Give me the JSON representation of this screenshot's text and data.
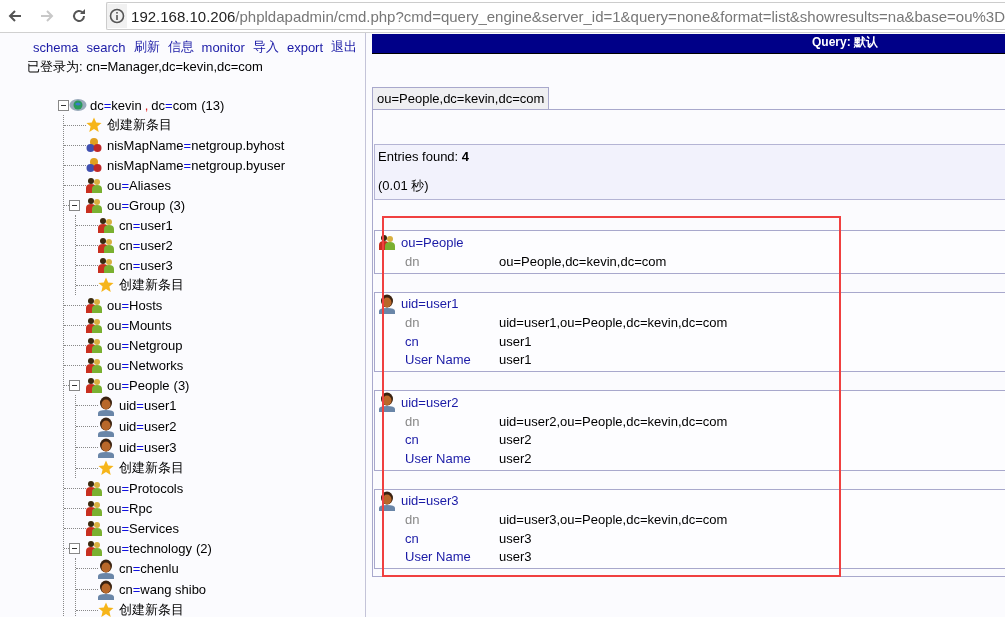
{
  "browser": {
    "nav": [
      {
        "kind": "back",
        "disabled": false
      },
      {
        "kind": "forward",
        "disabled": true
      },
      {
        "kind": "reload",
        "disabled": false
      }
    ],
    "address": {
      "host": "192.168.10.206",
      "path": "/phpldapadmin/cmd.php?cmd=query_engine&server_id=1&query=none&format=list&showresults=na&base=ou%3D"
    }
  },
  "menu": [
    "schema",
    "search",
    "刷新",
    "信息",
    "monitor",
    "导入",
    "export",
    "退出"
  ],
  "login": "已登录为: cn=Manager,dc=kevin,dc=com",
  "tree": {
    "kind": "server",
    "label": "dc=kevin,dc=com",
    "count": "(13)",
    "expanded": true,
    "children": [
      {
        "kind": "create",
        "label": "创建新条目"
      },
      {
        "kind": "nismap",
        "label": "nisMapName=netgroup.byhost"
      },
      {
        "kind": "nismap",
        "label": "nisMapName=netgroup.byuser"
      },
      {
        "kind": "ou",
        "label": "ou=Aliases"
      },
      {
        "kind": "ou",
        "label": "ou=Group",
        "count": "(3)",
        "expanded": true,
        "children": [
          {
            "kind": "ou",
            "label": "cn=user1"
          },
          {
            "kind": "ou",
            "label": "cn=user2"
          },
          {
            "kind": "ou",
            "label": "cn=user3"
          },
          {
            "kind": "create",
            "label": "创建新条目"
          }
        ]
      },
      {
        "kind": "ou",
        "label": "ou=Hosts"
      },
      {
        "kind": "ou",
        "label": "ou=Mounts"
      },
      {
        "kind": "ou",
        "label": "ou=Netgroup"
      },
      {
        "kind": "ou",
        "label": "ou=Networks"
      },
      {
        "kind": "ou",
        "label": "ou=People",
        "count": "(3)",
        "expanded": true,
        "children": [
          {
            "kind": "person",
            "label": "uid=user1"
          },
          {
            "kind": "person",
            "label": "uid=user2"
          },
          {
            "kind": "person",
            "label": "uid=user3"
          },
          {
            "kind": "create",
            "label": "创建新条目"
          }
        ]
      },
      {
        "kind": "ou",
        "label": "ou=Protocols"
      },
      {
        "kind": "ou",
        "label": "ou=Rpc"
      },
      {
        "kind": "ou",
        "label": "ou=Services"
      },
      {
        "kind": "ou",
        "label": "ou=technology",
        "count": "(2)",
        "expanded": true,
        "children": [
          {
            "kind": "person",
            "label": "cn=chenlu"
          },
          {
            "kind": "person",
            "label": "cn=wang shibo"
          },
          {
            "kind": "create",
            "label": "创建新条目"
          }
        ]
      }
    ]
  },
  "query": {
    "title": "Query: 默认",
    "tabs": [
      {
        "label": "ou=People,dc=kevin,dc=com",
        "selected": true
      }
    ],
    "summary": "Entries found: **4**",
    "time": "(0.01 秒)",
    "entries": [
      {
        "kind": "ou",
        "title": "ou=People",
        "attributes": [
          {
            "kind": "dn",
            "name": "dn",
            "value": "ou=People,dc=kevin,dc=com"
          }
        ]
      },
      {
        "kind": "person",
        "title": "uid=user1",
        "attributes": [
          {
            "kind": "dn",
            "name": "dn",
            "value": "uid=user1,ou=People,dc=kevin,dc=com"
          },
          {
            "kind": "attr",
            "name": "cn",
            "value": "user1"
          },
          {
            "kind": "attr",
            "name": "User Name",
            "value": "user1"
          }
        ]
      },
      {
        "kind": "person",
        "title": "uid=user2",
        "attributes": [
          {
            "kind": "dn",
            "name": "dn",
            "value": "uid=user2,ou=People,dc=kevin,dc=com"
          },
          {
            "kind": "attr",
            "name": "cn",
            "value": "user2"
          },
          {
            "kind": "attr",
            "name": "User Name",
            "value": "user2"
          }
        ]
      },
      {
        "kind": "person",
        "title": "uid=user3",
        "attributes": [
          {
            "kind": "dn",
            "name": "dn",
            "value": "uid=user3,ou=People,dc=kevin,dc=com"
          },
          {
            "kind": "attr",
            "name": "cn",
            "value": "user3"
          },
          {
            "kind": "attr",
            "name": "User Name",
            "value": "user3"
          }
        ]
      }
    ]
  }
}
